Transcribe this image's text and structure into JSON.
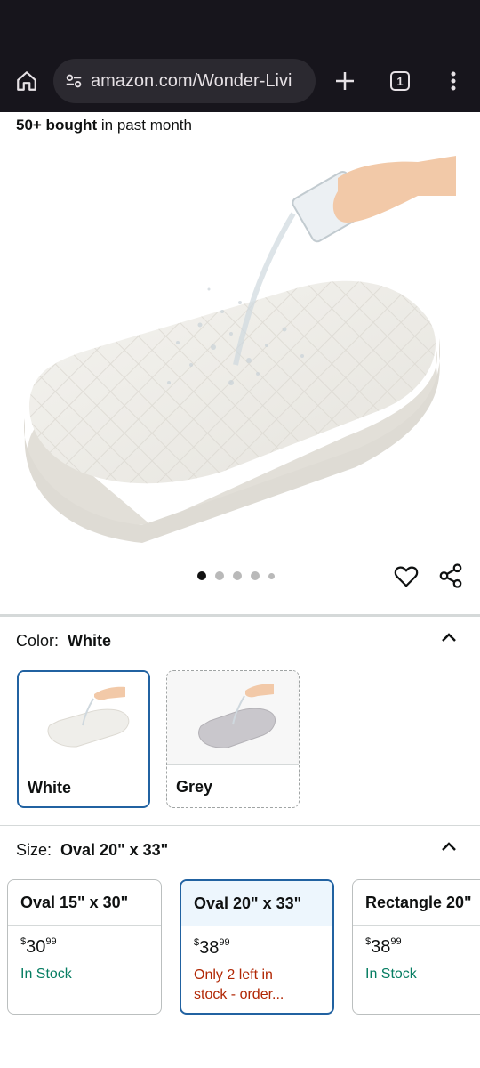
{
  "browser": {
    "url": "amazon.com/Wonder-Livi",
    "tab_count": "1"
  },
  "product": {
    "bought_count": "50+ bought",
    "bought_suffix": "in past month",
    "image_dots": 5,
    "active_image_index": 0
  },
  "color_selector": {
    "label": "Color:",
    "selected_value": "White",
    "options": [
      {
        "label": "White",
        "selected": true
      },
      {
        "label": "Grey",
        "selected": false
      }
    ]
  },
  "size_selector": {
    "label": "Size:",
    "selected_value": "Oval 20\" x 33\"",
    "options": [
      {
        "name": "Oval 15\" x 30\"",
        "currency": "$",
        "price_whole": "30",
        "price_fraction": "99",
        "stock": "In Stock",
        "selected": false
      },
      {
        "name": "Oval 20\" x 33\"",
        "currency": "$",
        "price_whole": "38",
        "price_fraction": "99",
        "stock_line1": "Only 2 left in",
        "stock_line2": "stock - order...",
        "selected": true
      },
      {
        "name": "Rectangle 20\"",
        "currency": "$",
        "price_whole": "38",
        "price_fraction": "99",
        "stock": "In Stock",
        "selected": false
      }
    ]
  },
  "colors": {
    "accent_blue": "#2162a1",
    "in_stock_green": "#067d62",
    "low_stock_red": "#b12704",
    "chrome_dark": "#17151c"
  }
}
